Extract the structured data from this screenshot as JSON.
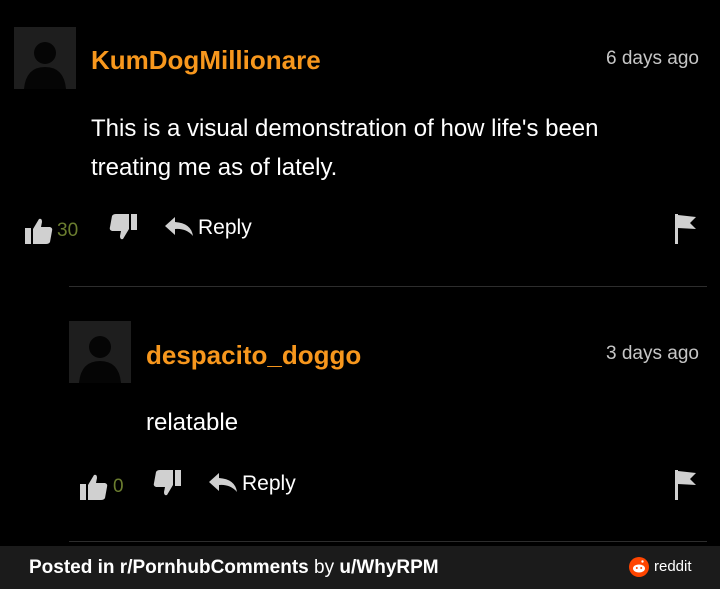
{
  "comments": [
    {
      "username": "KumDogMillionare",
      "time": "6 days ago",
      "text_lines": [
        "This is a visual demonstration of how life's been",
        "treating me as of lately."
      ],
      "likes": "30",
      "reply_label": "Reply"
    },
    {
      "username": "despacito_doggo",
      "time": "3 days ago",
      "text_lines": [
        "relatable"
      ],
      "likes": "0",
      "reply_label": "Reply"
    }
  ],
  "footer": {
    "posted_in": "Posted in",
    "subreddit": "r/PornhubComments",
    "by": "by",
    "user": "u/WhyRPM",
    "brand": "reddit"
  },
  "colors": {
    "username": "#f7971d",
    "like_count": "#6b7d2f",
    "background": "#000000",
    "footer_bg": "#1b1b1b",
    "reddit_brand": "#ff4500"
  },
  "icons": [
    "avatar-placeholder-icon",
    "thumbs-up-icon",
    "thumbs-down-icon",
    "reply-arrow-icon",
    "flag-icon",
    "reddit-logo-icon"
  ]
}
